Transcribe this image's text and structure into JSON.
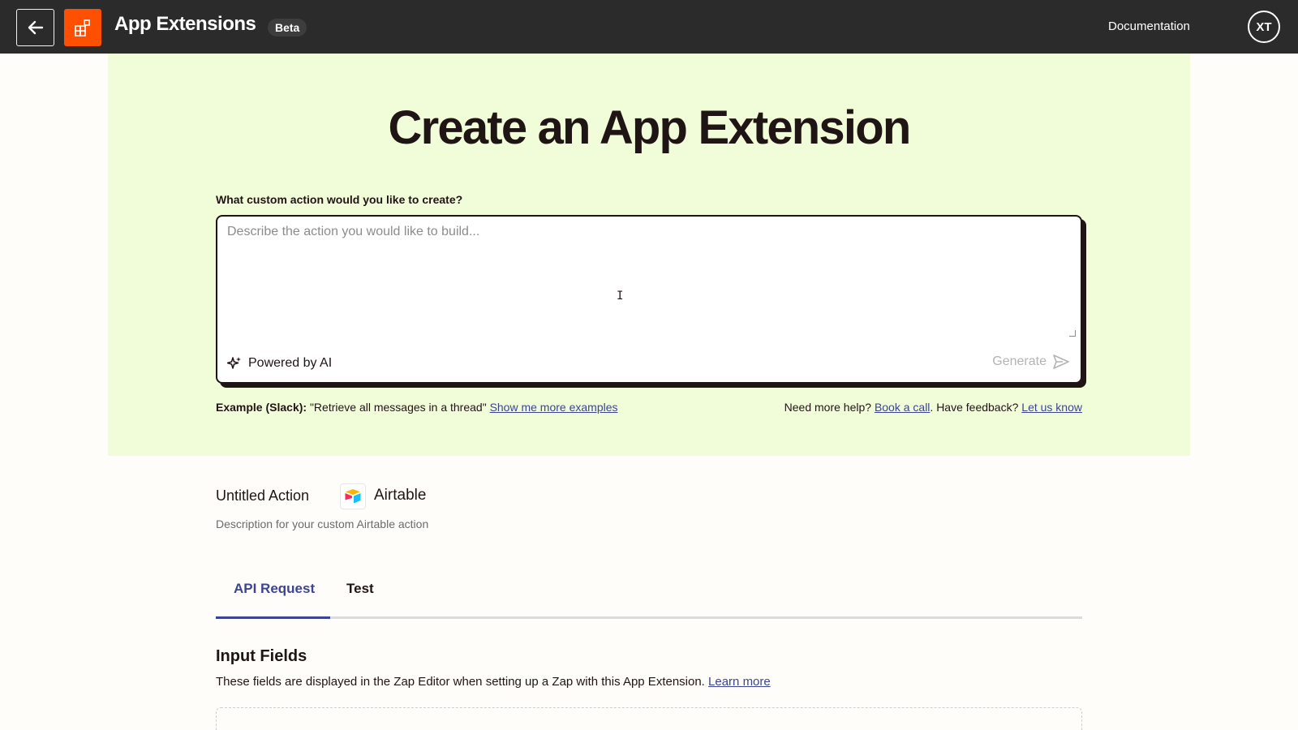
{
  "topbar": {
    "title": "App Extensions",
    "badge": "Beta",
    "documentation_label": "Documentation",
    "avatar_initials": "XT"
  },
  "hero": {
    "title": "Create an App Extension",
    "prompt_label": "What custom action would you like to create?",
    "prompt_placeholder": "Describe the action you would like to build...",
    "powered_label": "Powered by AI",
    "generate_label": "Generate",
    "example_prefix": "Example (Slack):",
    "example_text": " \"Retrieve all messages in a thread\" ",
    "example_link": "Show me more examples",
    "help_prefix": "Need more help? ",
    "help_link": "Book a call",
    "feedback_prefix": ". Have feedback? ",
    "feedback_link": "Let us know"
  },
  "action": {
    "name": "Untitled Action",
    "app_name": "Airtable",
    "description": "Description for your custom Airtable action"
  },
  "tabs": {
    "api": "API Request",
    "test": "Test"
  },
  "input_fields": {
    "title": "Input Fields",
    "description": "These fields are displayed in the Zap Editor when setting up a Zap with this App Extension. ",
    "learn_more": "Learn more"
  },
  "colors": {
    "brand_orange": "#ff4f00",
    "hero_bg": "#f1fcd9",
    "accent_blue": "#3d4592",
    "topbar_bg": "#2b2b2b"
  }
}
